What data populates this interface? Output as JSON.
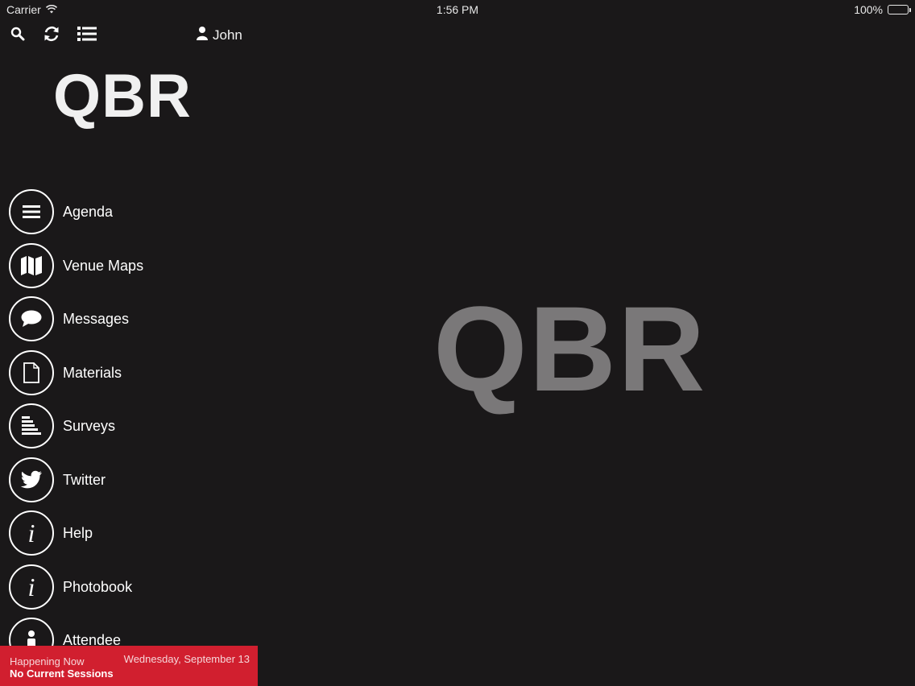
{
  "status_bar": {
    "carrier": "Carrier",
    "time": "1:56 PM",
    "battery": "100%",
    "battery_level": 1.0
  },
  "toolbar": {
    "icons": [
      "search-icon",
      "refresh-icon",
      "list-icon"
    ],
    "user_name": "John"
  },
  "sidebar": {
    "logo": "QBR",
    "items": [
      {
        "label": "Agenda",
        "icon": "agenda-icon"
      },
      {
        "label": "Venue Maps",
        "icon": "map-icon"
      },
      {
        "label": "Messages",
        "icon": "chat-bubble-icon"
      },
      {
        "label": "Materials",
        "icon": "document-icon"
      },
      {
        "label": "Surveys",
        "icon": "survey-icon"
      },
      {
        "label": "Twitter",
        "icon": "twitter-icon"
      },
      {
        "label": "Help",
        "icon": "info-icon"
      },
      {
        "label": "Photobook",
        "icon": "info-icon"
      },
      {
        "label": "Attendee",
        "icon": "attendee-icon"
      }
    ]
  },
  "happening_now": {
    "title": "Happening Now",
    "subtitle": "No Current Sessions",
    "date": "Wednesday, September 13"
  },
  "main": {
    "logo": "QBR"
  },
  "colors": {
    "background": "#1a1819",
    "accent_red": "#d11f2f",
    "logo_gray": "#7a7879"
  }
}
